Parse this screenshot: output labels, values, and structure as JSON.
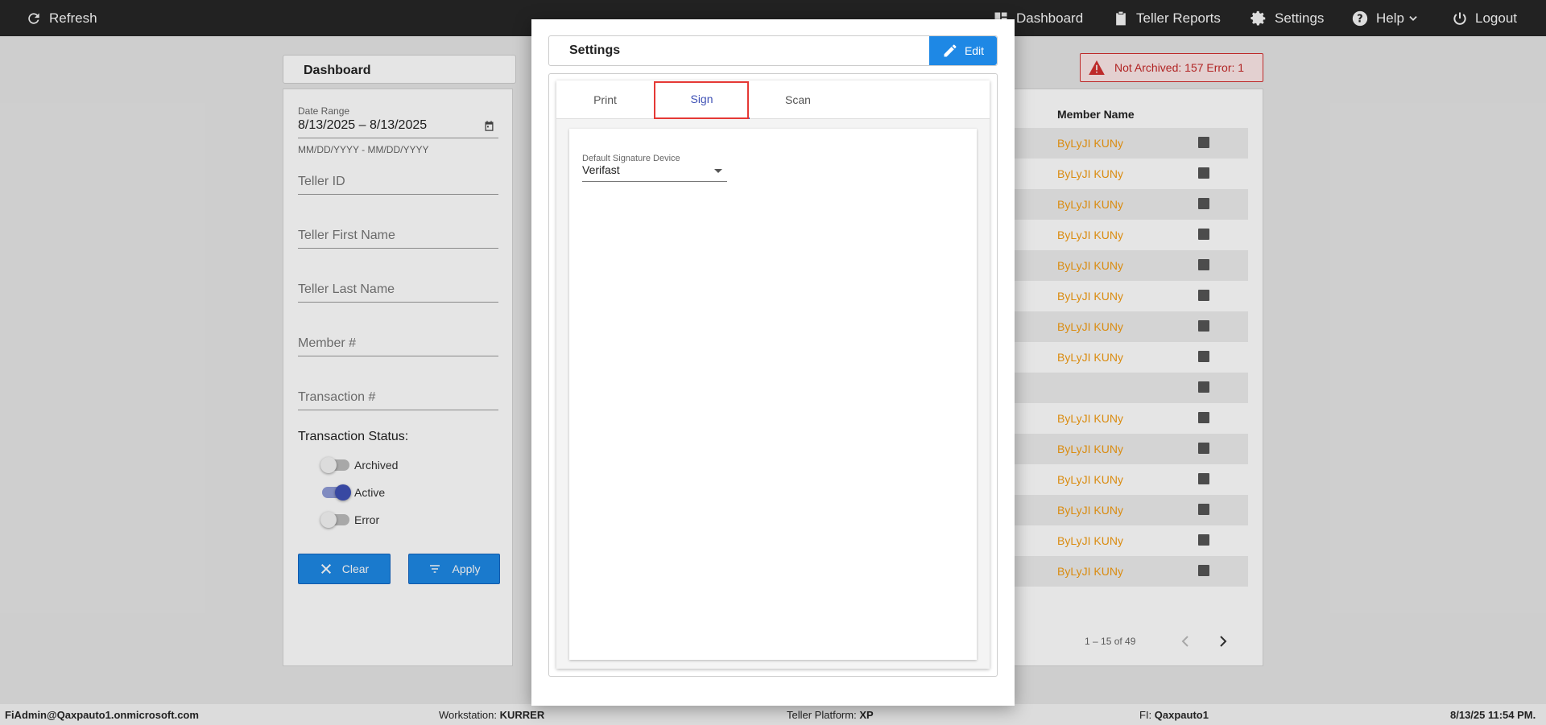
{
  "topbar": {
    "refresh_label": "Refresh",
    "dashboard_label": "Dashboard",
    "teller_reports_label": "Teller Reports",
    "settings_label": "Settings",
    "help_label": "Help",
    "logout_label": "Logout"
  },
  "dashboard": {
    "title": "Dashboard",
    "date_range_label": "Date Range",
    "date_range_value": "8/13/2025 – 8/13/2025",
    "date_range_hint": "MM/DD/YYYY - MM/DD/YYYY",
    "teller_id_placeholder": "Teller ID",
    "teller_first_name_placeholder": "Teller First Name",
    "teller_last_name_placeholder": "Teller Last Name",
    "member_placeholder": "Member #",
    "transaction_placeholder": "Transaction #",
    "status_label": "Transaction Status:",
    "status_options": [
      {
        "label": "Archived",
        "on": false
      },
      {
        "label": "Active",
        "on": true
      },
      {
        "label": "Error",
        "on": false
      }
    ],
    "clear_label": "Clear",
    "apply_label": "Apply"
  },
  "alert": {
    "text": "Not Archived: 157  Error: 1"
  },
  "table": {
    "member_name_header": "Member Name",
    "rows": [
      "ByLyJI KUNy",
      "ByLyJI KUNy",
      "ByLyJI KUNy",
      "ByLyJI KUNy",
      "ByLyJI KUNy",
      "ByLyJI KUNy",
      "ByLyJI KUNy",
      "ByLyJI KUNy",
      "",
      "ByLyJI KUNy",
      "ByLyJI KUNy",
      "ByLyJI KUNy",
      "ByLyJI KUNy",
      "ByLyJI KUNy",
      "ByLyJI KUNy"
    ],
    "pager_text": "1 – 15 of 49"
  },
  "modal": {
    "title": "Settings",
    "edit_label": "Edit",
    "tabs": [
      {
        "label": "Print",
        "active": false
      },
      {
        "label": "Sign",
        "active": true
      },
      {
        "label": "Scan",
        "active": false
      }
    ],
    "signature_device_label": "Default Signature Device",
    "signature_device_value": "Verifast"
  },
  "footer": {
    "user": "FiAdmin@Qaxpauto1.onmicrosoft.com",
    "workstation_label": "Workstation: ",
    "workstation_value": "KURRER",
    "platform_label": "Teller Platform: ",
    "platform_value": "XP",
    "fi_label": "FI: ",
    "fi_value": "Qaxpauto1",
    "datetime": "8/13/25 11:54 PM."
  }
}
